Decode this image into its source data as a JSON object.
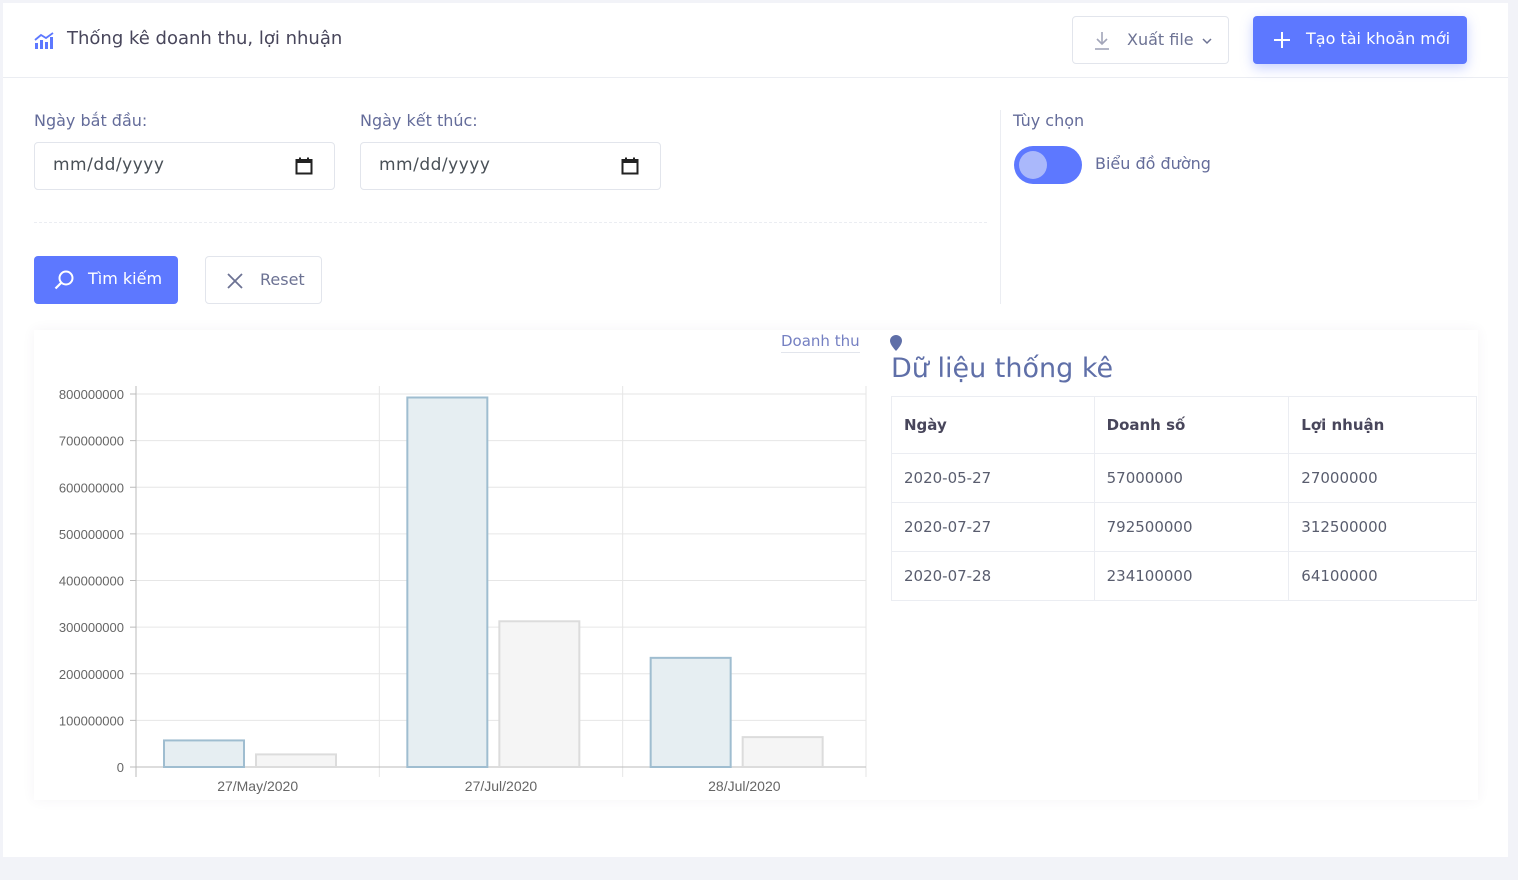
{
  "header": {
    "title": "Thống kê doanh thu, lợi nhuận",
    "export_label": "Xuất file",
    "new_account_label": "Tạo tài khoản mới"
  },
  "filters": {
    "start_label": "Ngày bắt đầu:",
    "end_label": "Ngày kết thúc:",
    "start_placeholder": "mm/dd/yyyy",
    "end_placeholder": "mm/dd/yyyy",
    "options_label": "Tùy chọn",
    "toggle_label": "Biểu đồ đường",
    "toggle_on": true,
    "search_label": "Tìm kiếm",
    "reset_label": "Reset"
  },
  "colors": {
    "accent": "#5d78ff",
    "bar_revenue_fill": "#e6eef2",
    "bar_revenue_stroke": "#9fbdd0",
    "bar_profit_fill": "#f5f5f5",
    "bar_profit_stroke": "#dcdcdc"
  },
  "chart_data": {
    "type": "bar",
    "title": "",
    "categories": [
      "27/May/2020",
      "27/Jul/2020",
      "28/Jul/2020"
    ],
    "series": [
      {
        "name": "Doanh thu",
        "values": [
          57000000,
          792500000,
          234100000
        ]
      },
      {
        "values": [
          27000000,
          312500000,
          64100000
        ]
      }
    ],
    "ylim": [
      0,
      800000000
    ],
    "yticks": [
      "0",
      "100000000",
      "200000000",
      "300000000",
      "400000000",
      "500000000",
      "600000000",
      "700000000",
      "800000000"
    ],
    "grid": true,
    "legend": "Doanh thu"
  },
  "stats": {
    "title": "Dữ liệu thống kê",
    "columns": [
      "Ngày",
      "Doanh số",
      "Lợi nhuận"
    ],
    "rows": [
      [
        "2020-05-27",
        "57000000",
        "27000000"
      ],
      [
        "2020-07-27",
        "792500000",
        "312500000"
      ],
      [
        "2020-07-28",
        "234100000",
        "64100000"
      ]
    ]
  }
}
